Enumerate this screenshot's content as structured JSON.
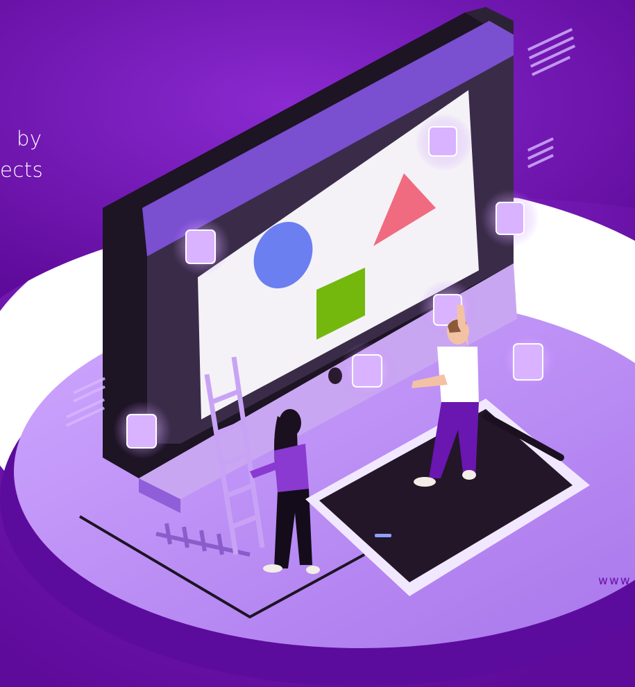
{
  "headline": {
    "line1": "by",
    "line2": "ects"
  },
  "footer": {
    "website": "www"
  },
  "colors": {
    "background_purple": "#6a0fa8",
    "platform_light": "#b58cf0",
    "platform_dark": "#5c0c9c",
    "circle_shape": "#6b7ff0",
    "triangle_shape": "#f06b80",
    "square_shape": "#74b80e",
    "tablet": "#2a1a30"
  },
  "icons": [
    "ladder-icon",
    "stylus-pen-icon",
    "drawing-tablet-icon",
    "monitor-icon"
  ]
}
